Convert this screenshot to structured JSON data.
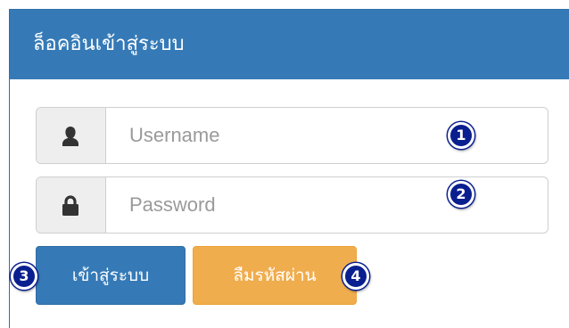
{
  "panel": {
    "title": "ล็อคอินเข้าสู่ระบบ"
  },
  "username": {
    "icon": "user-icon",
    "placeholder": "Username",
    "badge": "1"
  },
  "password": {
    "icon": "lock-icon",
    "placeholder": "Password",
    "badge": "2"
  },
  "buttons": {
    "login_label": "เข้าสู่ระบบ",
    "login_badge": "3",
    "forgot_label": "ลืมรหัสผ่าน",
    "forgot_badge": "4"
  },
  "colors": {
    "primary": "#357ab7",
    "warning": "#f0ad4e",
    "badge": "#0a1f8f"
  }
}
